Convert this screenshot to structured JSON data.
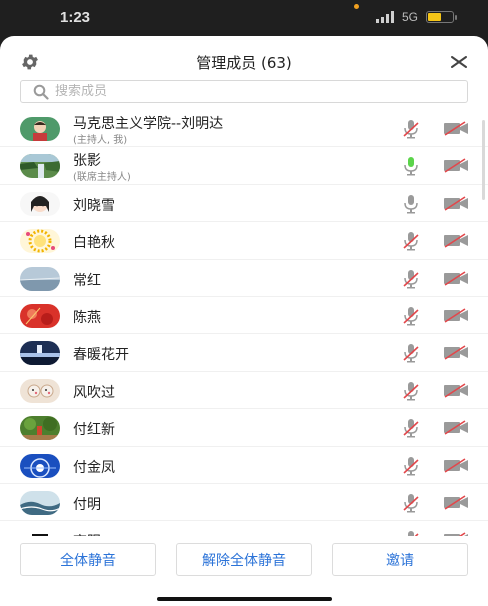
{
  "status": {
    "time": "1:23",
    "network": "5G",
    "battery_level": 0.55
  },
  "header": {
    "title": "管理成员 (63)"
  },
  "search": {
    "placeholder": "搜索成员"
  },
  "members": [
    {
      "name": "马克思主义学院--刘明达",
      "sub": "(主持人, 我)",
      "mic": "muted",
      "camera": "off"
    },
    {
      "name": "张影",
      "sub": "(联席主持人)",
      "mic": "speaking",
      "camera": "off"
    },
    {
      "name": "刘晓雪",
      "sub": "",
      "mic": "on",
      "camera": "off"
    },
    {
      "name": "白艳秋",
      "sub": "",
      "mic": "muted",
      "camera": "off"
    },
    {
      "name": "常红",
      "sub": "",
      "mic": "muted",
      "camera": "off"
    },
    {
      "name": "陈燕",
      "sub": "",
      "mic": "muted",
      "camera": "off"
    },
    {
      "name": "春暖花开",
      "sub": "",
      "mic": "muted",
      "camera": "off"
    },
    {
      "name": "风吹过",
      "sub": "",
      "mic": "muted",
      "camera": "off"
    },
    {
      "name": "付红新",
      "sub": "",
      "mic": "muted",
      "camera": "off"
    },
    {
      "name": "付金凤",
      "sub": "",
      "mic": "muted",
      "camera": "off"
    },
    {
      "name": "付明",
      "sub": "",
      "mic": "muted",
      "camera": "off"
    },
    {
      "name": "高阳",
      "sub": "",
      "mic": "muted",
      "camera": "off"
    }
  ],
  "footer": {
    "mute_all": "全体静音",
    "unmute_all": "解除全体静音",
    "invite": "邀请"
  },
  "colors": {
    "accent": "#2b73d8",
    "speaking": "#5bd44a",
    "muted_slash": "#e2474b",
    "icon_gray": "#9a9a9a"
  }
}
